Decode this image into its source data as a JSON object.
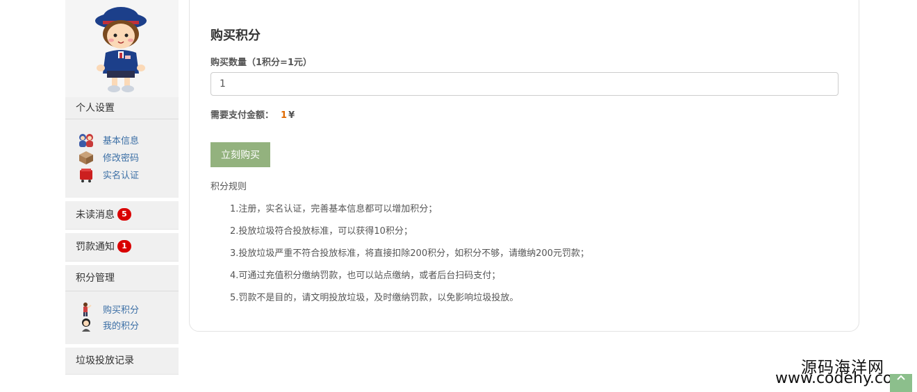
{
  "sidebar": {
    "personal_settings": {
      "heading": "个人设置",
      "items": [
        {
          "label": "基本信息",
          "icon": "users-icon"
        },
        {
          "label": "修改密码",
          "icon": "box-icon"
        },
        {
          "label": "实名认证",
          "icon": "cart-icon"
        }
      ]
    },
    "unread_messages": {
      "label": "未读消息",
      "count": "5"
    },
    "fine_notices": {
      "label": "罚款通知",
      "count": "1"
    },
    "points_management": {
      "heading": "积分管理",
      "items": [
        {
          "label": "购买积分",
          "icon": "person-pointing-icon"
        },
        {
          "label": "我的积分",
          "icon": "person-icon"
        }
      ]
    },
    "disposal_records": {
      "label": "垃圾投放记录"
    }
  },
  "main": {
    "title": "购买积分",
    "quantity_label": "购买数量（1积分=1元）",
    "quantity_value": "1",
    "pay_label": "需要支付金额：",
    "pay_amount": "1",
    "pay_currency": "¥",
    "buy_button": "立刻购买",
    "rules_title": "积分规则",
    "rules": [
      "1.注册，实名认证，完善基本信息都可以增加积分；",
      "2.投放垃圾符合投放标准，可以获得10积分；",
      "3.投放垃圾严重不符合投放标准，将直接扣除200积分，如积分不够，请缴纳200元罚款；",
      "4.可通过充值积分缴纳罚款，也可以站点缴纳，或者后台扫码支付；",
      "5.罚款不是目的，请文明投放垃圾，及时缴纳罚款，以免影响垃圾投放。"
    ]
  },
  "watermark": {
    "name": "源码海洋网",
    "url": "www.codehy.com"
  },
  "colors": {
    "accent_button": "#93b27e",
    "link": "#3a6ea5",
    "badge": "#d90000",
    "amount": "#e06a00"
  }
}
